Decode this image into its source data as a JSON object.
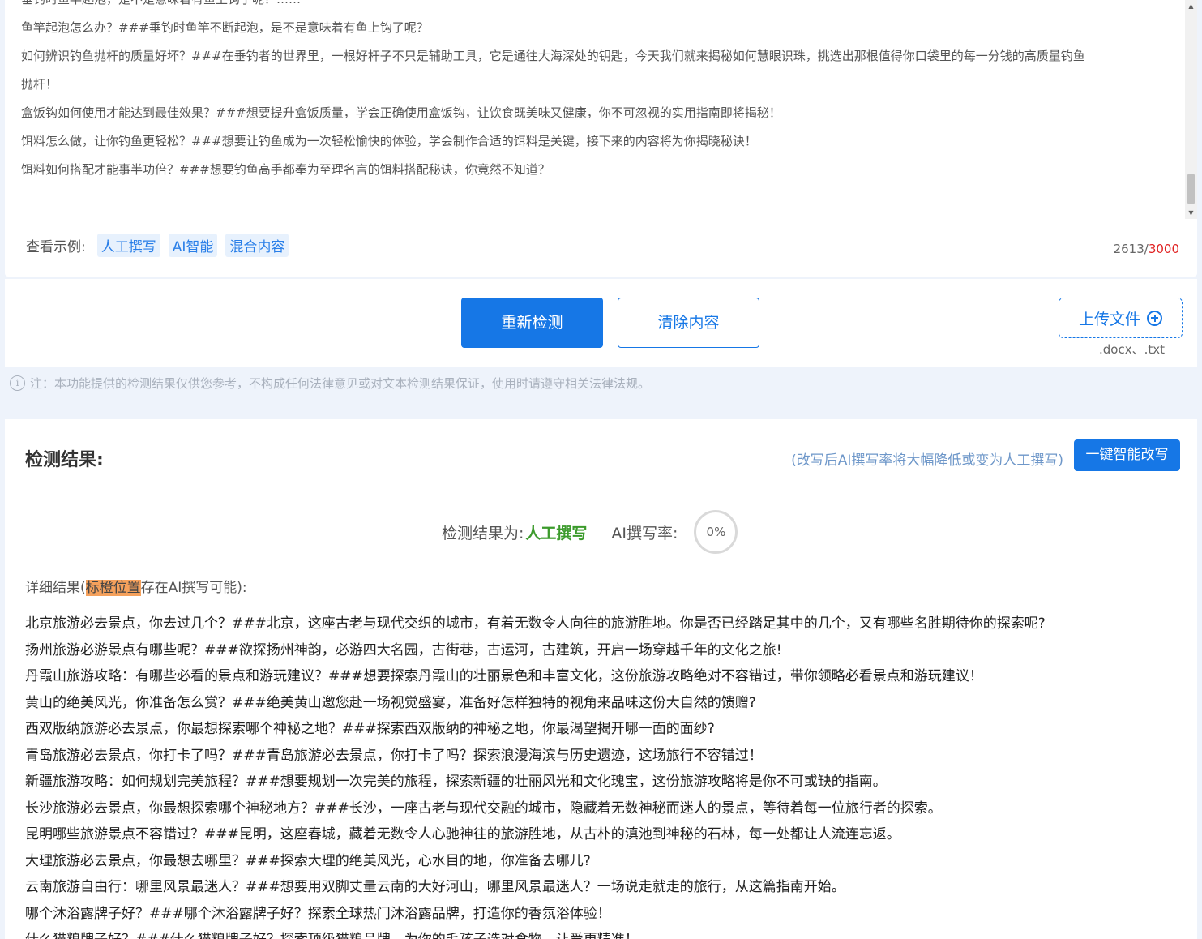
{
  "input": {
    "lines": [
      "垂钓时鱼竿起泡，是不是意味着有鱼上钩了呢？……",
      "鱼竿起泡怎么办？###垂钓时鱼竿不断起泡，是不是意味着有鱼上钩了呢？",
      "如何辨识钓鱼抛杆的质量好坏？###在垂钓者的世界里，一根好杆子不只是辅助工具，它是通往大海深处的钥匙，今天我们就来揭秘如何慧眼识珠，挑选出那根值得你口袋里的每一分钱的高质量钓鱼",
      "抛杆！",
      "盒饭钩如何使用才能达到最佳效果？###想要提升盒饭质量，学会正确使用盒饭钩，让饮食既美味又健康，你不可忽视的实用指南即将揭秘！",
      "饵料怎么做，让你钓鱼更轻松？###想要让钓鱼成为一次轻松愉快的体验，学会制作合适的饵料是关键，接下来的内容将为你揭晓秘诀！",
      "饵料如何搭配才能事半功倍？###想要钓鱼高手都奉为至理名言的饵料搭配秘诀，你竟然不知道？"
    ],
    "examples_label": "查看示例:",
    "examples": [
      "人工撰写",
      "AI智能",
      "混合内容"
    ],
    "count": "2613",
    "count_sep": "/",
    "count_max": "3000",
    "scroll_up_icon": "▲",
    "scroll_down_icon": "▼"
  },
  "actions": {
    "recheck_label": "重新检测",
    "clear_label": "清除内容",
    "upload_label": "上传文件",
    "upload_types": ".docx、.txt"
  },
  "notice": {
    "icon": "i",
    "text": "注：本功能提供的检测结果仅供您参考，不构成任何法律意见或对文本检测结果保证，使用时请遵守相关法律法规。"
  },
  "result": {
    "title": "检测结果:",
    "rewrite_hint": "(改写后AI撰写率将大幅降低或变为人工撰写)",
    "rewrite_label": "一键智能改写",
    "verdict_label": "检测结果为:",
    "verdict_value": "人工撰写",
    "rate_label": "AI撰写率:",
    "rate_value": "0%",
    "detail_prefix": "详细结果(",
    "detail_highlight": "标橙位置",
    "detail_suffix": "存在AI撰写可能):",
    "lines": [
      "北京旅游必去景点，你去过几个？###北京，这座古老与现代交织的城市，有着无数令人向往的旅游胜地。你是否已经踏足其中的几个，又有哪些名胜期待你的探索呢?",
      "扬州旅游必游景点有哪些呢？###欲探扬州神韵，必游四大名园，古街巷，古运河，古建筑，开启一场穿越千年的文化之旅!",
      "丹霞山旅游攻略：有哪些必看的景点和游玩建议？###想要探索丹霞山的壮丽景色和丰富文化，这份旅游攻略绝对不容错过，带你领略必看景点和游玩建议！",
      "黄山的绝美风光，你准备怎么赏？###绝美黄山邀您赴一场视觉盛宴，准备好怎样独特的视角来品味这份大自然的馈赠?",
      "西双版纳旅游必去景点，你最想探索哪个神秘之地？###探索西双版纳的神秘之地，你最渴望揭开哪一面的面纱?",
      "青岛旅游必去景点，你打卡了吗？###青岛旅游必去景点，你打卡了吗？探索浪漫海滨与历史遗迹，这场旅行不容错过！",
      "新疆旅游攻略：如何规划完美旅程？###想要规划一次完美的旅程，探索新疆的壮丽风光和文化瑰宝，这份旅游攻略将是你不可或缺的指南。",
      "长沙旅游必去景点，你最想探索哪个神秘地方？###长沙，一座古老与现代交融的城市，隐藏着无数神秘而迷人的景点，等待着每一位旅行者的探索。",
      "昆明哪些旅游景点不容错过？###昆明，这座春城，藏着无数令人心驰神往的旅游胜地，从古朴的滇池到神秘的石林，每一处都让人流连忘返。",
      "大理旅游必去景点，你最想去哪里？###探索大理的绝美风光，心水目的地，你准备去哪儿?",
      "云南旅游自由行：哪里风景最迷人？###想要用双脚丈量云南的大好河山，哪里风景最迷人？一场说走就走的旅行，从这篇指南开始。",
      "哪个沐浴露牌子好？###哪个沐浴露牌子好？探索全球热门沐浴露品牌，打造你的香氛浴体验！",
      "什么猫粮牌子好？###什么猫粮牌子好？探索顶级猫粮品牌，为你的毛孩子选对食物，让爱更精准！"
    ]
  },
  "colors": {
    "primary": "#1677e6",
    "verdict_green": "#3c9b2c",
    "highlight_orange": "#f5a15c",
    "counter_red": "#e02020",
    "page_bg": "#eef3fb"
  }
}
